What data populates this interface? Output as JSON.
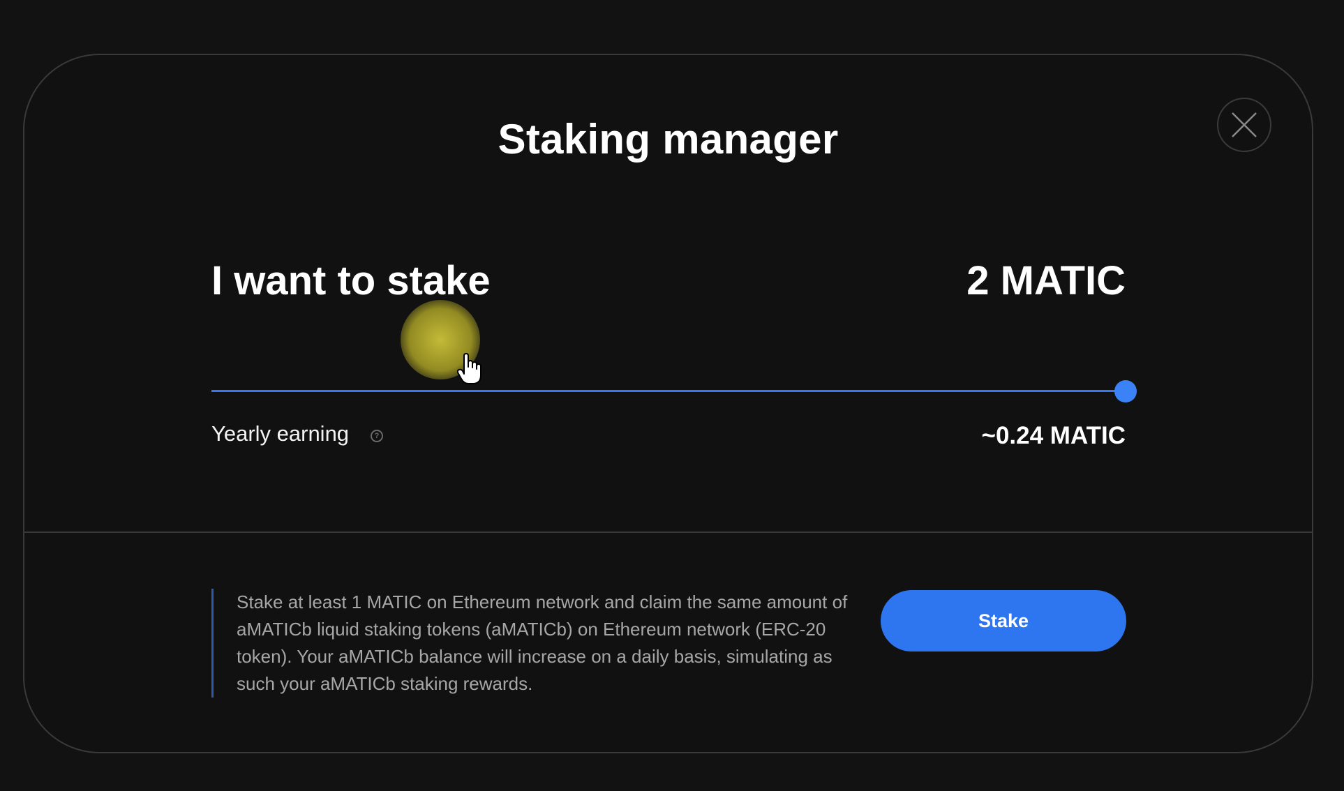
{
  "modal": {
    "title": "Staking manager",
    "close_icon": "close-icon"
  },
  "stake": {
    "label": "I want to stake",
    "amount": "2 MATIC",
    "slider_level": 1.0
  },
  "earning": {
    "label": "Yearly earning",
    "help_icon": "question-circle-icon",
    "help_glyph": "?",
    "value": "~0.24 MATIC"
  },
  "info": {
    "text": "Stake at least 1 MATIC on Ethereum network and claim the same amount of aMATICb liquid staking tokens (aMATICb) on Ethereum network (ERC-20 token). Your aMATICb balance will increase on a daily basis, simulating as such your aMATICb staking rewards."
  },
  "actions": {
    "stake_label": "Stake"
  },
  "colors": {
    "accent": "#2d76f0",
    "background": "#111111",
    "cursor_highlight": "#d7cd3c"
  }
}
